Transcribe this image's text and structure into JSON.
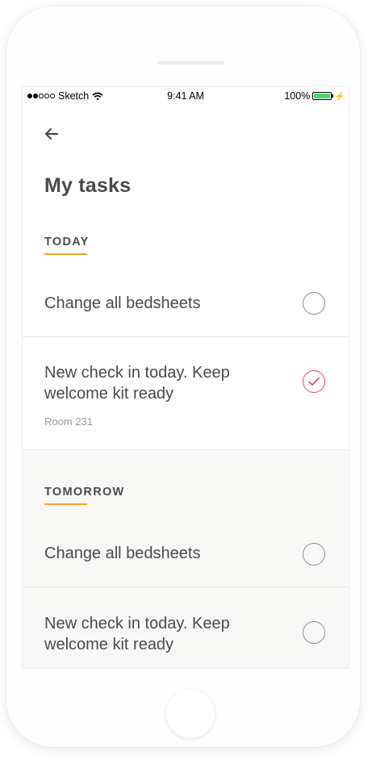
{
  "status_bar": {
    "carrier": "Sketch",
    "time": "9:41 AM",
    "battery": "100%"
  },
  "header": {
    "back_icon": "arrow-left-icon",
    "title": "My tasks"
  },
  "sections": [
    {
      "label": "TODAY",
      "tasks": [
        {
          "text": "Change all bedsheets",
          "meta": "",
          "completed": false
        },
        {
          "text": "New check in today. Keep welcome kit ready",
          "meta": "Room 231",
          "completed": true
        }
      ]
    },
    {
      "label": "TOMORROW",
      "tasks": [
        {
          "text": "Change all bedsheets",
          "meta": "",
          "completed": false
        },
        {
          "text": "New check in today. Keep welcome kit ready",
          "meta": "",
          "completed": false
        }
      ]
    }
  ],
  "colors": {
    "accent_underline": "#f5a623",
    "checked": "#e84a5f",
    "battery": "#4cd964",
    "tomorrow_bg": "#f8f8f7"
  }
}
